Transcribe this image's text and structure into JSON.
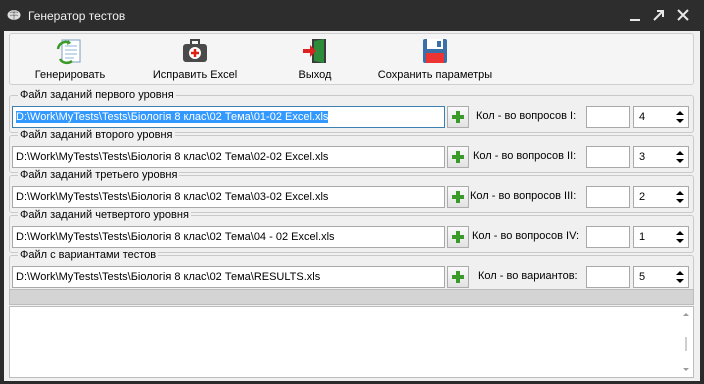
{
  "window": {
    "title": "Генератор тестов",
    "icon": "brain-icon"
  },
  "toolbar": {
    "generate_label": "Генерировать",
    "fix_excel_label": "Исправить Excel",
    "exit_label": "Выход",
    "save_params_label": "Сохранить параметры"
  },
  "groups": [
    {
      "caption": "Файл заданий первого уровня",
      "path": "D:\\Work\\MyTests\\Tests\\Біологія 8 клас\\02 Тема\\01-02  Excel.xls",
      "count_label": "Кол - во вопросов I:",
      "count_value": "4",
      "selected": true
    },
    {
      "caption": "Файл заданий второго уровня",
      "path": "D:\\Work\\MyTests\\Tests\\Біологія 8 клас\\02 Тема\\02-02   Excel.xls",
      "count_label": "Кол - во вопросов II:",
      "count_value": "3"
    },
    {
      "caption": "Файл заданий третьего уровня",
      "path": "D:\\Work\\MyTests\\Tests\\Біологія 8 клас\\02 Тема\\03-02  Excel.xls",
      "count_label": "Кол - во вопросов III:",
      "count_value": "2"
    },
    {
      "caption": "Файл заданий четвертого уровня",
      "path": "D:\\Work\\MyTests\\Tests\\Біологія 8 клас\\02 Тема\\04 - 02  Excel.xls",
      "count_label": "Кол - во вопросов IV:",
      "count_value": "1"
    },
    {
      "caption": "Файл с вариантами тестов",
      "path": "D:\\Work\\MyTests\\Tests\\Біологія 8 клас\\02 Тема\\RESULTS.xls",
      "count_label": "Кол - во вариантов:",
      "count_value": "5"
    }
  ],
  "colors": {
    "titlebar": "#2d2d2d",
    "selection": "#3399ff",
    "accent_green": "#3a9a2a"
  }
}
